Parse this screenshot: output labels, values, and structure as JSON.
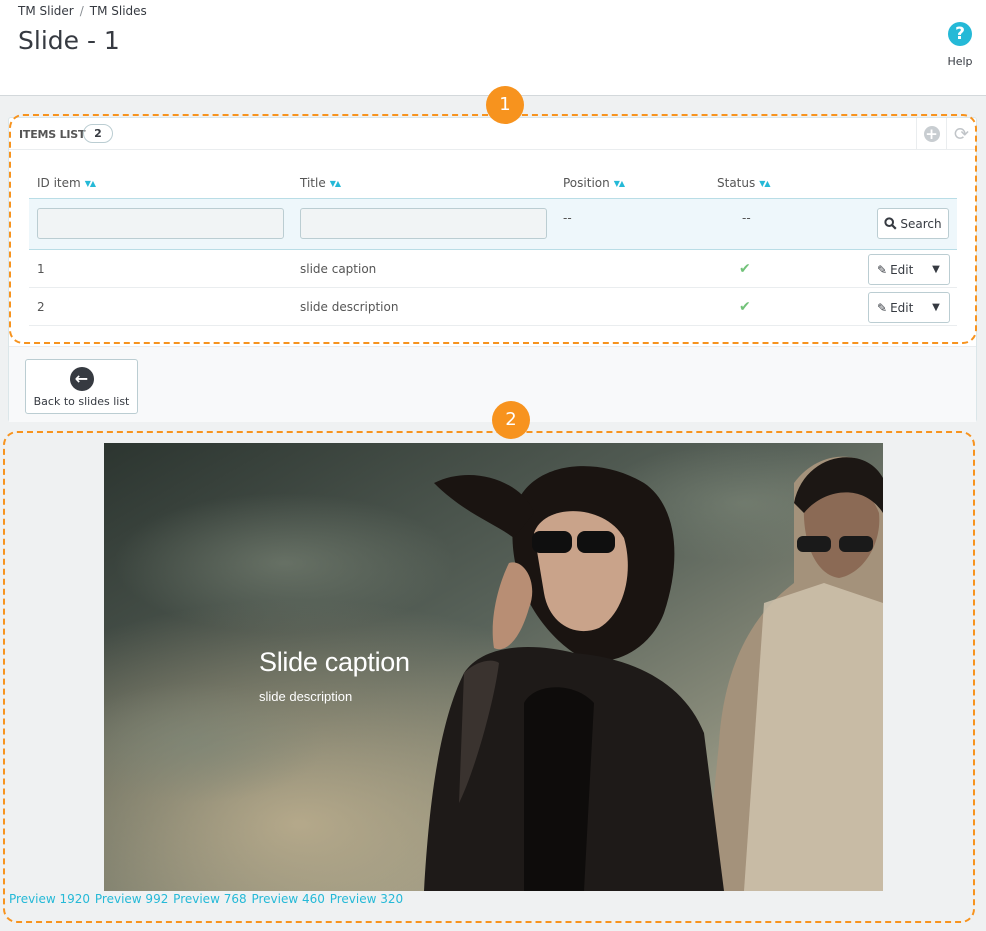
{
  "header": {
    "breadcrumb": [
      "TM Slider",
      "TM Slides"
    ],
    "breadcrumb_separator": "/",
    "title": "Slide - 1",
    "help_label": "Help",
    "help_icon": "question-circle-icon"
  },
  "list": {
    "title": "ITEMS LIST",
    "count": "2",
    "columns": [
      "ID item",
      "Title",
      "Position",
      "Status"
    ],
    "filter_placeholder_dash": "--",
    "search_label": "Search",
    "rows": [
      {
        "id": "1",
        "title": "slide caption",
        "status": "enabled",
        "edit_label": "Edit"
      },
      {
        "id": "2",
        "title": "slide description",
        "status": "enabled",
        "edit_label": "Edit"
      }
    ]
  },
  "footer": {
    "back_label": "Back to slides list"
  },
  "callouts": [
    "1",
    "2"
  ],
  "slide": {
    "caption": "Slide caption",
    "description": "slide description"
  },
  "preview_links": [
    "Preview 1920",
    "Preview 992",
    "Preview 768",
    "Preview 460",
    "Preview 320"
  ],
  "colors": {
    "accent": "#25b9d7",
    "callout": "#f7931e",
    "status_ok": "#72c279"
  }
}
